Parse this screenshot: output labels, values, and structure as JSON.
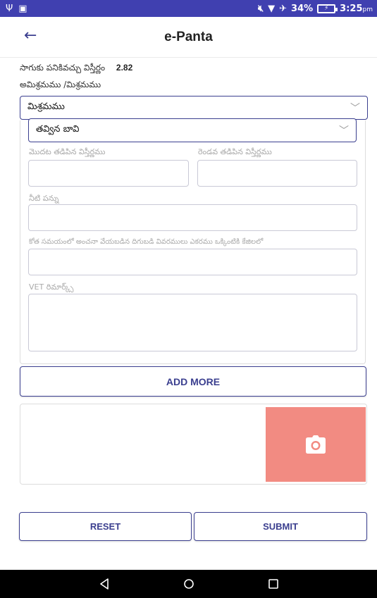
{
  "status_bar": {
    "battery": "34%",
    "time": "3:25",
    "ampm": "pm",
    "left_icons": [
      "usb-icon",
      "image-icon"
    ],
    "right_icons": [
      "mute-icon",
      "wifi-icon",
      "airplane-icon",
      "battery-icon"
    ]
  },
  "app_bar": {
    "title": "e-Panta"
  },
  "form": {
    "cultivable_area_label": "సాగుకు పనికివచ్చు విస్తీర్ణం",
    "cultivable_area_value": "2.82",
    "crop_type_label": "అమిశ్రమము /మిశ్రమము",
    "crop_type_selected": "మిశ్రమము",
    "source_selected": "తవ్విన బావి",
    "first_wet_area_label": "మొదట తడిపిన విస్తీర్ణము",
    "second_wet_area_label": "రెండవ తడిపిన విస్తీర్ణము",
    "water_tax_label": "నీటి పన్ను",
    "yield_estimate_label": "కోత సమయంలో అంచనా వేయబడిన దిగుబడి వివరములు ఎకరము ఒక్కింటికి కేజిలలో",
    "vet_remarks_label": "VET రిమార్క్స్"
  },
  "buttons": {
    "add_more": "ADD MORE",
    "reset": "RESET",
    "submit": "SUBMIT"
  },
  "colors": {
    "status_bar": "#4040b0",
    "primary": "#3b3f8f",
    "camera_bg": "#f28b82"
  }
}
